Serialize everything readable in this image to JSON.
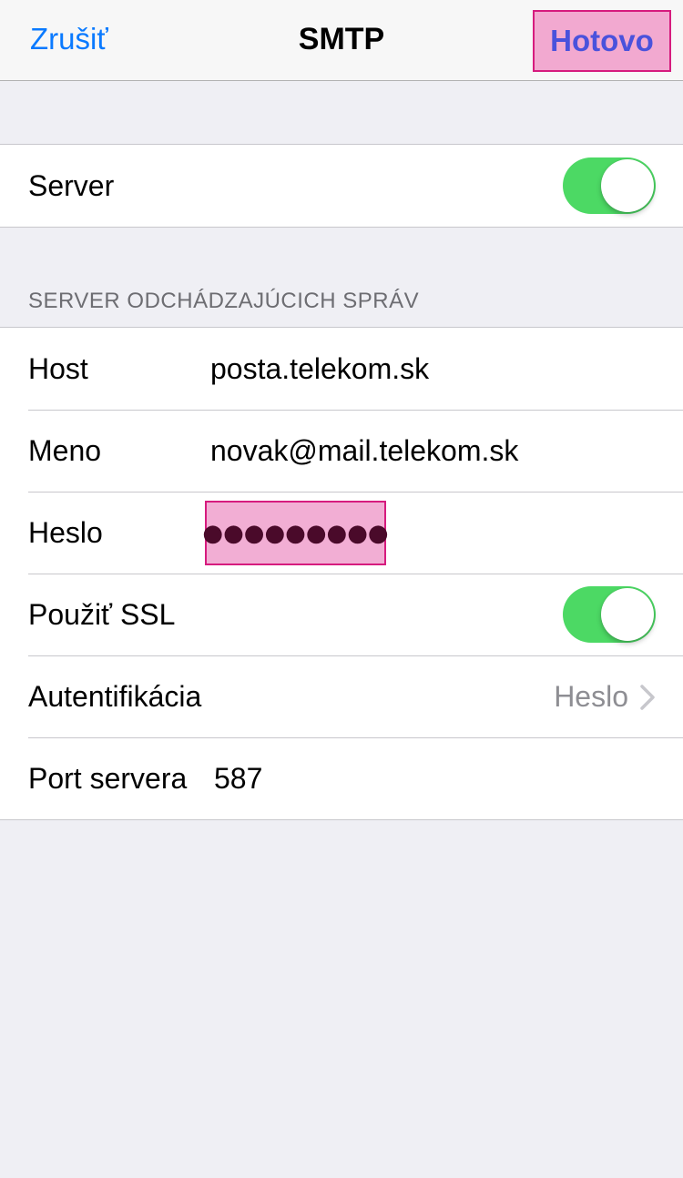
{
  "nav": {
    "cancel_label": "Zrušiť",
    "title": "SMTP",
    "done_label": "Hotovo"
  },
  "server_group": {
    "server_label": "Server",
    "server_enabled": true
  },
  "outgoing": {
    "section_title": "SERVER ODCHÁDZAJÚCICH SPRÁV",
    "host_label": "Host",
    "host_value": "posta.telekom.sk",
    "name_label": "Meno",
    "name_value": "novak@mail.telekom.sk",
    "password_label": "Heslo",
    "password_value": "●●●●●●●●●",
    "ssl_label": "Použiť SSL",
    "ssl_enabled": true,
    "auth_label": "Autentifikácia",
    "auth_value": "Heslo",
    "port_label": "Port servera",
    "port_value": "587"
  },
  "colors": {
    "accent": "#0a7aff",
    "toggle_on": "#4cd964",
    "highlight_fill": "#f2a9d0",
    "highlight_border": "#d61b7e"
  }
}
